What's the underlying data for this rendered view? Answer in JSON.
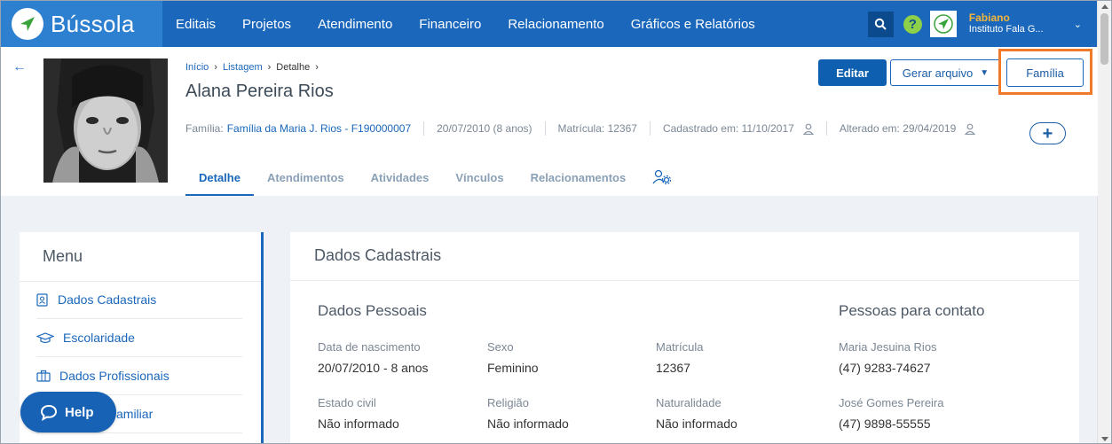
{
  "app": {
    "name": "Bússola"
  },
  "nav": {
    "items": [
      {
        "label": "Editais"
      },
      {
        "label": "Projetos"
      },
      {
        "label": "Atendimento"
      },
      {
        "label": "Financeiro"
      },
      {
        "label": "Relacionamento"
      },
      {
        "label": "Gráficos e Relatórios"
      }
    ],
    "help_symbol": "?"
  },
  "user": {
    "name": "Fabiano",
    "institution": "Instituto Fala G..."
  },
  "breadcrumb": {
    "inicio": "Início",
    "listagem": "Listagem",
    "detalhe": "Detalhe"
  },
  "person": {
    "name": "Alana Pereira Rios",
    "familia_label": "Família:",
    "familia_value": "Família da Maria J. Rios - F190000007",
    "birth": "20/07/2010 (8 anos)",
    "matricula": "Matrícula: 12367",
    "cadastrado": "Cadastrado em: 11/10/2017",
    "alterado": "Alterado em: 29/04/2019"
  },
  "actions": {
    "editar": "Editar",
    "gerar": "Gerar arquivo",
    "familia": "Família",
    "add": "+"
  },
  "tabs": [
    {
      "label": "Detalhe",
      "active": true
    },
    {
      "label": "Atendimentos"
    },
    {
      "label": "Atividades"
    },
    {
      "label": "Vínculos"
    },
    {
      "label": "Relacionamentos"
    }
  ],
  "menu": {
    "title": "Menu",
    "items": [
      {
        "label": "Dados Cadastrais",
        "icon": "id-card-icon"
      },
      {
        "label": "Escolaridade",
        "icon": "graduation-cap-icon"
      },
      {
        "label": "Dados Profissionais",
        "icon": "briefcase-icon"
      },
      {
        "label": "Familiar",
        "icon": "family-icon"
      }
    ],
    "partial_item": "amiliar"
  },
  "help": {
    "label": "Help"
  },
  "card": {
    "title": "Dados Cadastrais",
    "pessoais_title": "Dados Pessoais",
    "contato_title": "Pessoas para contato",
    "fields": [
      {
        "label": "Data de nascimento",
        "value": "20/07/2010 - 8 anos"
      },
      {
        "label": "Sexo",
        "value": "Feminino"
      },
      {
        "label": "Matrícula",
        "value": "12367"
      },
      {
        "label": "Estado civil",
        "value": "Não informado"
      },
      {
        "label": "Religião",
        "value": "Não informado"
      },
      {
        "label": "Naturalidade",
        "value": "Não informado"
      }
    ],
    "contacts": [
      {
        "name": "Maria Jesuina Rios",
        "phone": "(47) 9283-74627"
      },
      {
        "name": "José Gomes Pereira",
        "phone": "(47) 9898-55555"
      }
    ]
  },
  "colors": {
    "nav_bg": "#1a67bb",
    "logo_bg": "#2d7fd0",
    "accent": "#1a67bb",
    "highlight": "#f07a2a",
    "user_name": "#f5b538"
  }
}
